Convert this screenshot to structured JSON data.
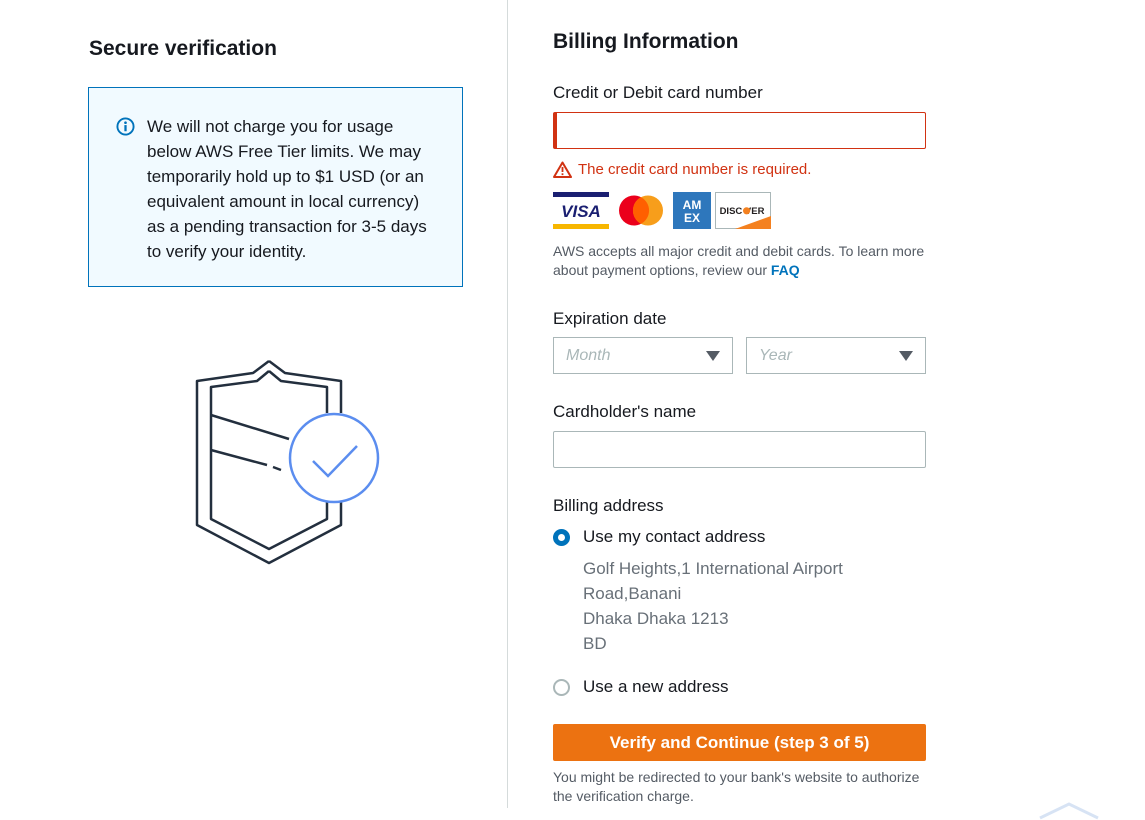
{
  "left": {
    "title": "Secure verification",
    "info_text": "We will not charge you for usage below AWS Free Tier limits. We may temporarily hold up to $1 USD (or an equivalent amount in local currency) as a pending transaction for 3-5 days to verify your identity."
  },
  "billing": {
    "title": "Billing Information",
    "card_number_label": "Credit or Debit card number",
    "card_number_value": "",
    "card_error": "The credit card number is required.",
    "card_brands": [
      "VISA",
      "mastercard",
      "AMEX",
      "DISCOVER"
    ],
    "accept_text": "AWS accepts all major credit and debit cards. To learn more about payment options, review our",
    "faq_link": "FAQ",
    "expiration_label": "Expiration date",
    "month_placeholder": "Month",
    "year_placeholder": "Year",
    "cardholder_label": "Cardholder's name",
    "cardholder_value": "",
    "billing_address_label": "Billing address",
    "use_contact_label": "Use my contact address",
    "address_lines": [
      "Golf Heights,1 International Airport",
      "Road,Banani",
      "Dhaka Dhaka 1213",
      "BD"
    ],
    "use_new_label": "Use a new address",
    "verify_button": "Verify and Continue (step 3 of 5)",
    "redirect_note": "You might be redirected to your bank's website to authorize the verification charge."
  },
  "colors": {
    "accent": "#0073bb",
    "error": "#d13212",
    "primary_button": "#ec7211"
  }
}
